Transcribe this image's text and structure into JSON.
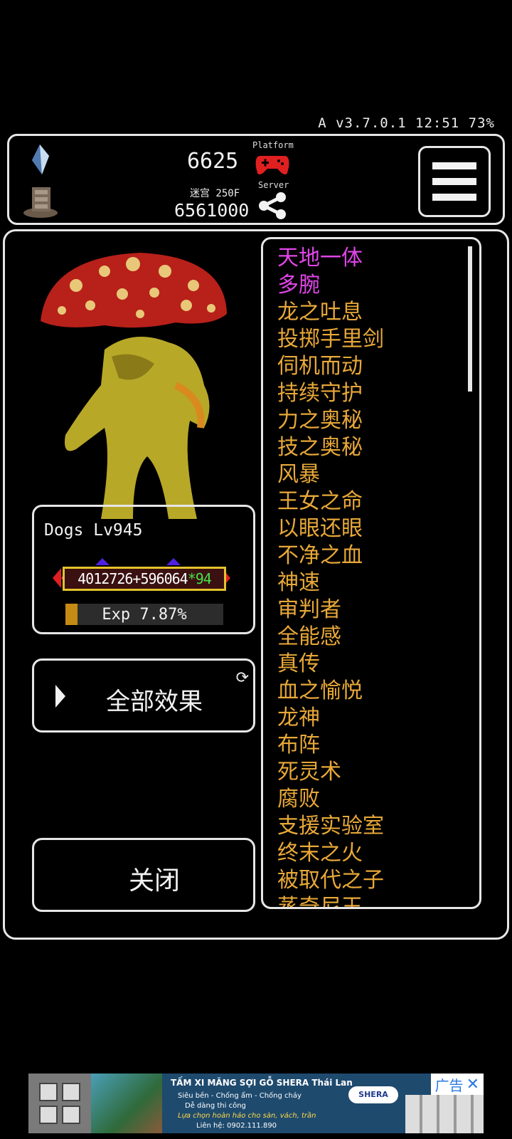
{
  "status_bar": {
    "text": "A v3.7.0.1 12:51 73%"
  },
  "header": {
    "gold_value": "6625",
    "maze_label": "迷宫 250F",
    "maze_value": "6561000",
    "platform_label": "Platform",
    "server_label": "Server",
    "icons": [
      "crystal-icon",
      "stairs-icon",
      "gamepad-icon",
      "share-icon",
      "menu-icon"
    ]
  },
  "monster": {
    "name_level": "Dogs Lv945",
    "hp_main": "4012726+596064",
    "hp_mult": "*94",
    "exp_text": "Exp 7.87%",
    "exp_fraction": 0.0787
  },
  "buttons": {
    "all_effects": "全部效果",
    "close": "关闭"
  },
  "skills": [
    {
      "name": "天地一体",
      "special": true
    },
    {
      "name": "多腕",
      "special": true
    },
    {
      "name": "龙之吐息",
      "special": false
    },
    {
      "name": "投掷手里剑",
      "special": false
    },
    {
      "name": "伺机而动",
      "special": false
    },
    {
      "name": "持续守护",
      "special": false
    },
    {
      "name": "力之奥秘",
      "special": false
    },
    {
      "name": "技之奥秘",
      "special": false
    },
    {
      "name": "风暴",
      "special": false
    },
    {
      "name": "王女之命",
      "special": false
    },
    {
      "name": "以眼还眼",
      "special": false
    },
    {
      "name": "不净之血",
      "special": false
    },
    {
      "name": "神速",
      "special": false
    },
    {
      "name": "审判者",
      "special": false
    },
    {
      "name": "全能感",
      "special": false
    },
    {
      "name": "真传",
      "special": false
    },
    {
      "name": "血之愉悦",
      "special": false
    },
    {
      "name": "龙神",
      "special": false
    },
    {
      "name": "布阵",
      "special": false
    },
    {
      "name": "死灵术",
      "special": false
    },
    {
      "name": "腐败",
      "special": false
    },
    {
      "name": "支援实验室",
      "special": false
    },
    {
      "name": "终末之火",
      "special": false
    },
    {
      "name": "被取代之子",
      "special": false
    },
    {
      "name": "蒸奇尼王",
      "special": false
    }
  ],
  "colors": {
    "skill_special": "#e045e8",
    "skill_normal": "#e8a838",
    "hp_mult": "#44e24a",
    "exp_fill": "#c58a14"
  },
  "ad": {
    "title": "TẤM XI MĂNG SỢI GỖ SHERA Thái Lan",
    "line1": "Siêu bền - Chống ẩm - Chống cháy",
    "line2": "Dễ dàng thi công",
    "line3": "Lựa chọn hoàn hảo cho sàn, vách, trần",
    "phone": "Liên hệ: 0902.111.890",
    "brand": "SHERA",
    "badge": "广告"
  }
}
